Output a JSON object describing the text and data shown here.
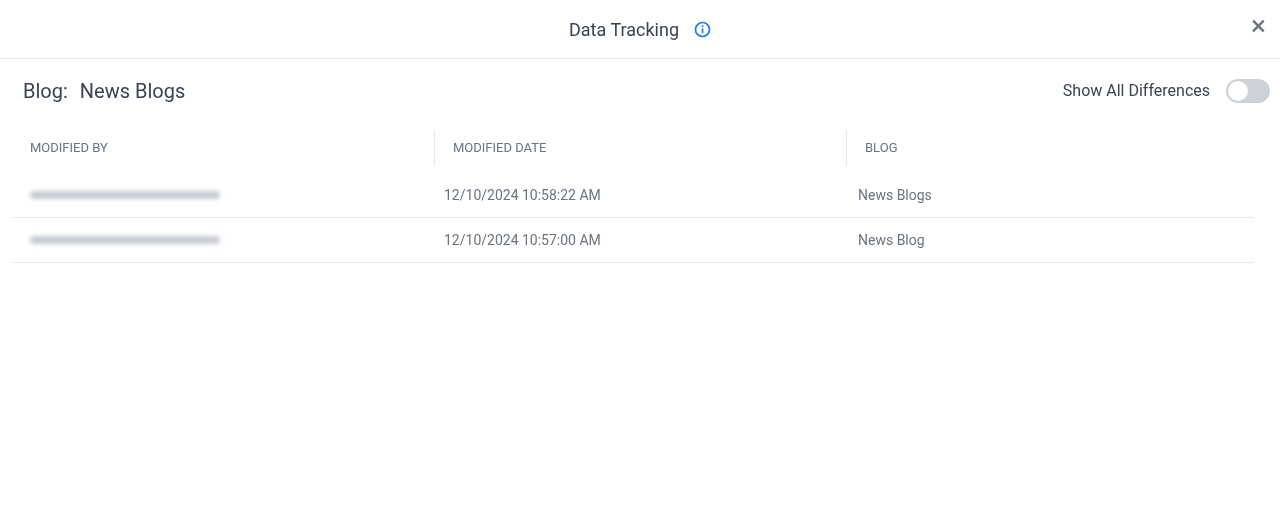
{
  "dialog": {
    "title": "Data Tracking",
    "close": "×"
  },
  "blog": {
    "label": "Blog:",
    "value": "News Blogs"
  },
  "toggle": {
    "label": "Show All Differences",
    "on": false
  },
  "table": {
    "columns": [
      "MODIFIED BY",
      "MODIFIED DATE",
      "BLOG"
    ],
    "rows": [
      {
        "modified_by_redacted": true,
        "modified_date": "12/10/2024 10:58:22 AM",
        "blog": "News Blogs"
      },
      {
        "modified_by_redacted": true,
        "modified_date": "12/10/2024 10:57:00 AM",
        "blog": "News Blog"
      }
    ]
  }
}
